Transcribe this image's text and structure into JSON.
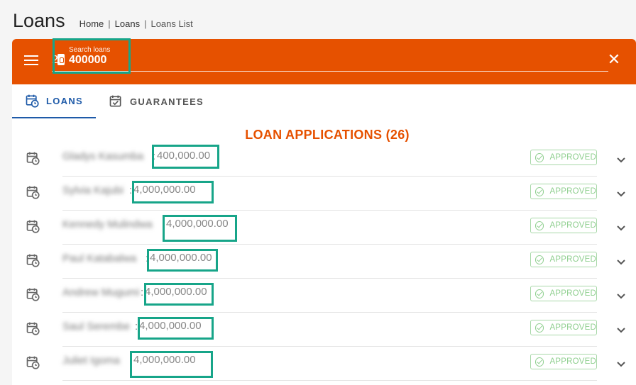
{
  "page": {
    "title": "Loans",
    "breadcrumb": [
      "Home",
      "Loans",
      "Loans List"
    ]
  },
  "search": {
    "label": "Search loans",
    "value": "400000",
    "prefix": "2"
  },
  "tabs": [
    {
      "label": "LOANS",
      "active": true,
      "icon": "calendar-clock-icon"
    },
    {
      "label": "GUARANTEES",
      "active": false,
      "icon": "calendar-check-icon"
    }
  ],
  "section": {
    "heading": "LOAN APPLICATIONS (26)"
  },
  "loans": [
    {
      "name": "Gladys Kasumba",
      "amount": "400,000.00",
      "status": "APPROVED"
    },
    {
      "name": "Sylvia Kajubi",
      "amount": "4,000,000.00",
      "status": "APPROVED"
    },
    {
      "name": "Kennedy Mulindwa",
      "amount": "4,000,000.00",
      "status": "APPROVED"
    },
    {
      "name": "Paul Katabalwa",
      "amount": "4,000,000.00",
      "status": "APPROVED"
    },
    {
      "name": "Andrew Mugumi",
      "amount": "4,000,000.00",
      "status": "APPROVED"
    },
    {
      "name": "Saul Serembe",
      "amount": "4,000,000.00",
      "status": "APPROVED"
    },
    {
      "name": "Juliet Igoma",
      "amount": "4,000,000.00",
      "status": "APPROVED"
    }
  ],
  "colors": {
    "brand": "#e65100",
    "tab_active": "#1e5aa8",
    "approved": "#8fcf8f",
    "highlight": "#17a589"
  }
}
